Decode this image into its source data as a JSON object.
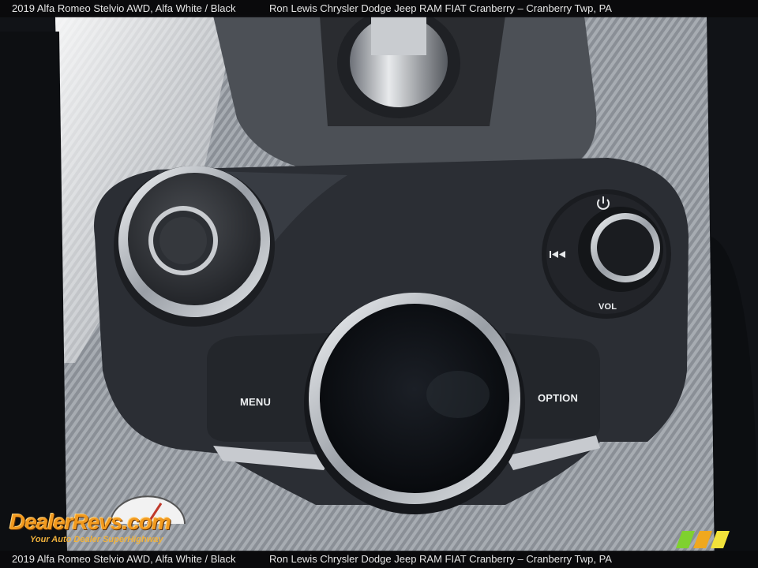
{
  "caption": {
    "car": "2019 Alfa Romeo Stelvio AWD,   Alfa White  /  Black",
    "dealer": "Ron Lewis Chrysler Dodge Jeep RAM FIAT Cranberry – Cranberry Twp, PA"
  },
  "caption_bottom": {
    "car": "2019 Alfa Romeo Stelvio AWD,   Alfa White  /  Black",
    "dealer": "Ron Lewis Chrysler Dodge Jeep RAM FIAT Cranberry – Cranberry Twp, PA"
  },
  "controls": {
    "menu_label": "MENU",
    "option_label": "OPTION",
    "vol_label": "VOL"
  },
  "watermark": {
    "brand": "DealerRevs.com",
    "tagline": "Your Auto Dealer SuperHighway"
  },
  "colors": {
    "caption_bg": "#0a0a0c",
    "console": "#2a2d33",
    "chrome": "#d4d7db",
    "logo_orange": "#f29a1f"
  }
}
